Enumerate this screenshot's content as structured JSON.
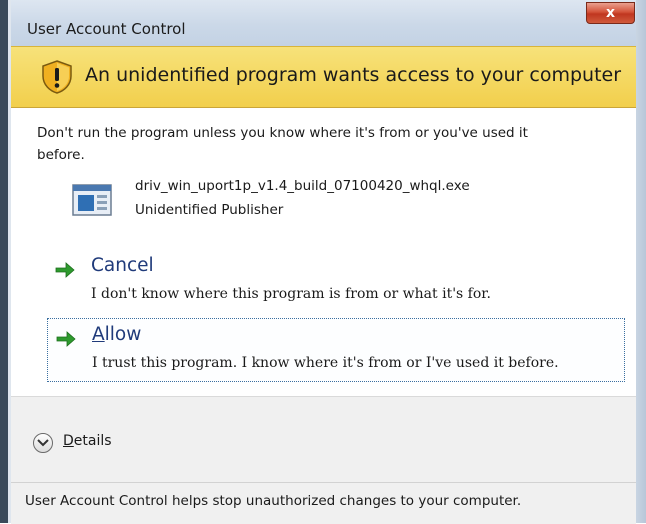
{
  "window": {
    "title": "User Account Control",
    "close_label": "x"
  },
  "banner": {
    "icon": "shield-warning-icon",
    "message": "An unidentified program wants access to your computer",
    "color": "#f2cf4c"
  },
  "body": {
    "warning_line1": "Don't run the program unless you know where it's from or you've used it",
    "warning_line2": "before.",
    "program": {
      "icon": "program-icon",
      "name": "driv_win_uport1p_v1.4_build_07100420_whql.exe",
      "publisher": "Unidentified Publisher"
    }
  },
  "options": {
    "cancel": {
      "icon": "green-arrow-icon",
      "label": "Cancel",
      "description": "I don't know where this program is from or what it's for."
    },
    "allow": {
      "icon": "green-arrow-icon",
      "label_underlined": "A",
      "label_rest": "llow",
      "description": "I trust this program. I know where it's from or I've used it before."
    }
  },
  "details": {
    "icon": "chevron-down-icon",
    "label_underlined": "D",
    "label_rest": "etails"
  },
  "footer": {
    "text": "User Account Control helps stop unauthorized changes to your computer."
  }
}
